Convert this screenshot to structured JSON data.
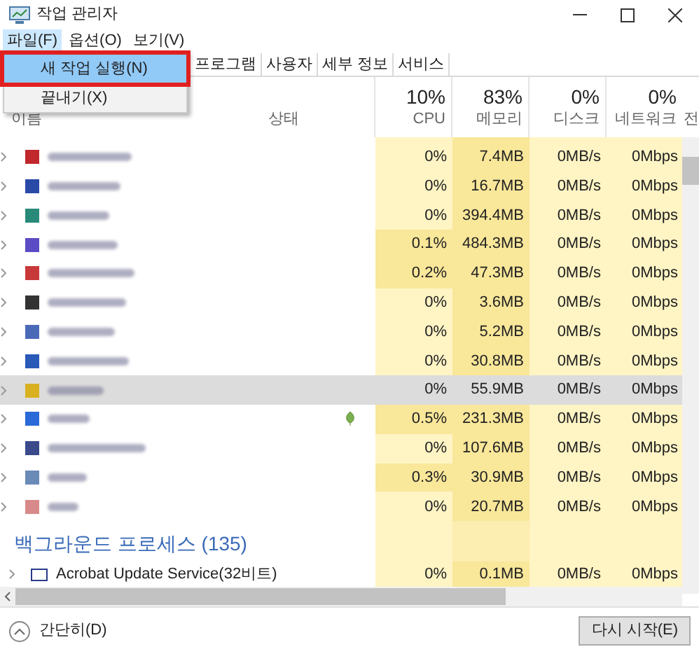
{
  "window": {
    "title": "작업 관리자"
  },
  "menu_bar": [
    {
      "label": "파일(F)",
      "selected": true
    },
    {
      "label": "옵션(O)",
      "selected": false
    },
    {
      "label": "보기(V)",
      "selected": false
    }
  ],
  "file_menu": [
    {
      "label": "새 작업 실행(N)",
      "selected": true
    },
    {
      "label": "끝내기(X)",
      "selected": false
    }
  ],
  "tabs": [
    {
      "label": "프로그램",
      "selected": false
    },
    {
      "label": "사용자",
      "selected": false
    },
    {
      "label": "세부 정보",
      "selected": false
    },
    {
      "label": "서비스",
      "selected": false
    }
  ],
  "columns": [
    {
      "label": "이름"
    },
    {
      "label": "상태"
    },
    {
      "percent": "10%",
      "label": "CPU"
    },
    {
      "percent": "83%",
      "label": "메모리"
    },
    {
      "percent": "0%",
      "label": "디스크"
    },
    {
      "percent": "0%",
      "label": "네트워크"
    },
    {
      "label": "전"
    }
  ],
  "rows": [
    {
      "color": "#c0282d",
      "selected": false,
      "cpu_high": false,
      "leaf": false,
      "cpu": "0%",
      "memory": "7.4MB",
      "disk": "0MB/s",
      "network": "0Mbps"
    },
    {
      "color": "#2a4aa8",
      "selected": false,
      "cpu_high": false,
      "leaf": false,
      "cpu": "0%",
      "memory": "16.7MB",
      "disk": "0MB/s",
      "network": "0Mbps"
    },
    {
      "color": "#2a8a7a",
      "selected": false,
      "cpu_high": false,
      "leaf": false,
      "cpu": "0%",
      "memory": "394.4MB",
      "disk": "0MB/s",
      "network": "0Mbps"
    },
    {
      "color": "#5b4bc4",
      "selected": false,
      "cpu_high": true,
      "leaf": false,
      "cpu": "0.1%",
      "memory": "484.3MB",
      "disk": "0MB/s",
      "network": "0Mbps"
    },
    {
      "color": "#c83a3a",
      "selected": false,
      "cpu_high": true,
      "leaf": false,
      "cpu": "0.2%",
      "memory": "47.3MB",
      "disk": "0MB/s",
      "network": "0Mbps"
    },
    {
      "color": "#333333",
      "selected": false,
      "cpu_high": false,
      "leaf": false,
      "cpu": "0%",
      "memory": "3.6MB",
      "disk": "0MB/s",
      "network": "0Mbps"
    },
    {
      "color": "#4a6ab8",
      "selected": false,
      "cpu_high": false,
      "leaf": false,
      "cpu": "0%",
      "memory": "5.2MB",
      "disk": "0MB/s",
      "network": "0Mbps"
    },
    {
      "color": "#2a5ab8",
      "selected": false,
      "cpu_high": false,
      "leaf": false,
      "cpu": "0%",
      "memory": "30.8MB",
      "disk": "0MB/s",
      "network": "0Mbps"
    },
    {
      "color": "#d8b020",
      "selected": true,
      "cpu_high": false,
      "leaf": false,
      "cpu": "0%",
      "memory": "55.9MB",
      "disk": "0MB/s",
      "network": "0Mbps"
    },
    {
      "color": "#2a6ad8",
      "selected": false,
      "cpu_high": true,
      "leaf": true,
      "cpu": "0.5%",
      "memory": "231.3MB",
      "disk": "0MB/s",
      "network": "0Mbps"
    },
    {
      "color": "#3a4a8a",
      "selected": false,
      "cpu_high": false,
      "leaf": false,
      "cpu": "0%",
      "memory": "107.6MB",
      "disk": "0MB/s",
      "network": "0Mbps"
    },
    {
      "color": "#6a8ab8",
      "selected": false,
      "cpu_high": true,
      "leaf": false,
      "cpu": "0.3%",
      "memory": "30.9MB",
      "disk": "0MB/s",
      "network": "0Mbps"
    },
    {
      "color": "#d88a8a",
      "selected": false,
      "cpu_high": false,
      "leaf": false,
      "cpu": "0%",
      "memory": "20.7MB",
      "disk": "0MB/s",
      "network": "0Mbps"
    }
  ],
  "background_group": {
    "label": "백그라운드 프로세스 (135)"
  },
  "background_rows": [
    {
      "name": "Acrobat Update Service(32비트)",
      "cpu": "0%",
      "memory": "0.1MB",
      "disk": "0MB/s",
      "network": "0Mbps"
    }
  ],
  "footer": {
    "collapse": "간단히(D)",
    "button": "다시 시작(E)"
  }
}
